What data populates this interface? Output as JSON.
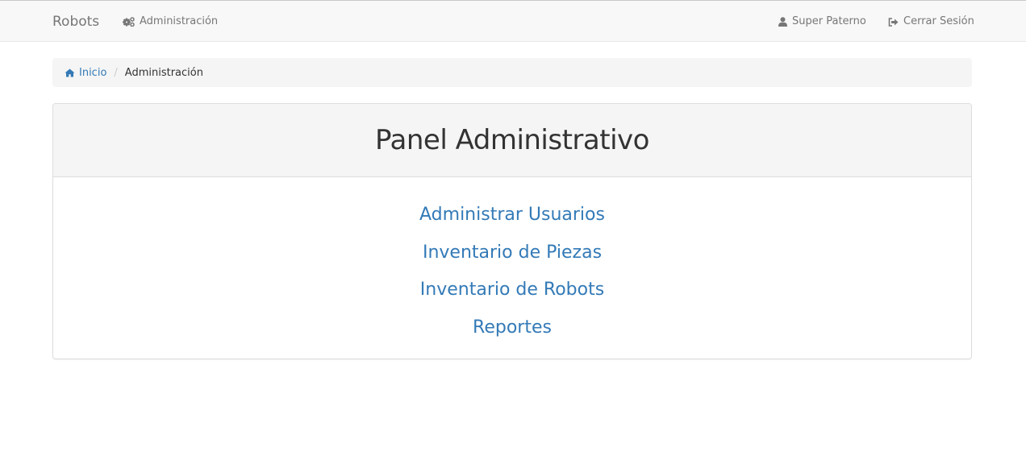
{
  "navbar": {
    "brand": "Robots",
    "admin_label": "Administración",
    "user_label": "Super Paterno",
    "logout_label": "Cerrar Sesión"
  },
  "breadcrumb": {
    "home_label": "Inicio",
    "separator": "/",
    "current_label": "Administración"
  },
  "panel": {
    "title": "Panel Administrativo",
    "links": [
      {
        "label": "Administrar Usuarios"
      },
      {
        "label": "Inventario de Piezas"
      },
      {
        "label": "Inventario de Robots"
      },
      {
        "label": "Reportes"
      }
    ]
  },
  "colors": {
    "link": "#337ab7",
    "navbar_bg": "#f8f8f8",
    "nav_text": "#777777",
    "panel_heading_bg": "#f5f5f5"
  },
  "icons": {
    "admin": "cogs-icon",
    "user": "user-icon",
    "logout": "sign-out-icon",
    "home": "home-icon"
  }
}
